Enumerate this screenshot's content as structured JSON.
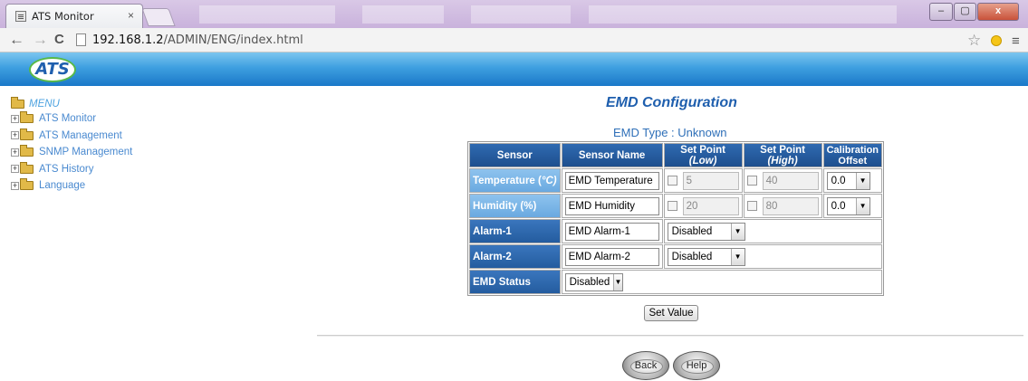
{
  "browser": {
    "tab_title": "ATS Monitor",
    "tab_close": "×",
    "url_host": "192.168.1.2",
    "url_path": "/ADMIN/ENG/index.html",
    "back": "←",
    "forward": "→",
    "reload": "C",
    "star": "☆",
    "menu": "≡",
    "win_min": "–",
    "win_max": "▢",
    "win_close": "x"
  },
  "banner": {
    "logo": "ATS"
  },
  "menu": {
    "root": "MENU",
    "items": [
      "ATS Monitor",
      "ATS Management",
      "SNMP Management",
      "ATS History",
      "Language"
    ]
  },
  "page": {
    "title": "EMD Configuration",
    "emd_type": "EMD Type : Unknown"
  },
  "table": {
    "headers": {
      "sensor": "Sensor",
      "sensor_name": "Sensor Name",
      "set_low_prefix": "Set Point ",
      "set_low_em": "(Low)",
      "set_high_prefix": "Set Point ",
      "set_high_em": "(High)",
      "cal_1": "Calibration",
      "cal_2": "Offset"
    },
    "rows": [
      {
        "label": "Temperature (",
        "unit": "°C)",
        "name": "EMD Temperature",
        "low": "5",
        "high": "40",
        "offset": "0.0"
      },
      {
        "label": "Humidity (%)",
        "name": "EMD Humidity",
        "low": "20",
        "high": "80",
        "offset": "0.0"
      },
      {
        "label": "Alarm-1",
        "name": "EMD Alarm-1",
        "state": "Disabled"
      },
      {
        "label": "Alarm-2",
        "name": "EMD Alarm-2",
        "state": "Disabled"
      },
      {
        "label": "EMD Status",
        "state": "Disabled"
      }
    ]
  },
  "actions": {
    "set_value": "Set Value",
    "back": "Back",
    "help": "Help"
  }
}
